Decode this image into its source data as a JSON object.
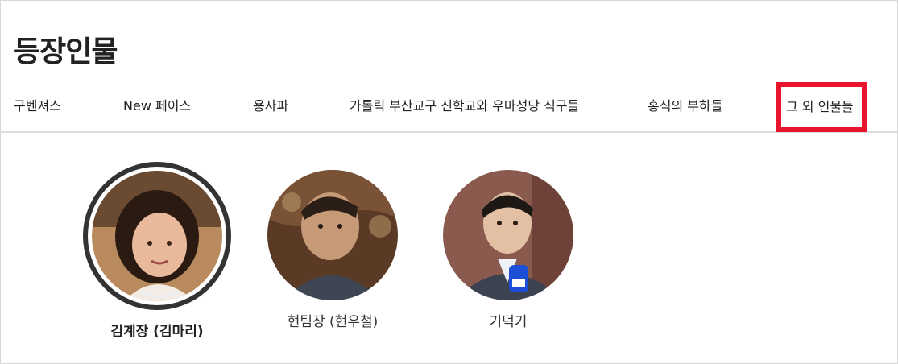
{
  "page": {
    "title": "등장인물"
  },
  "tabs": [
    {
      "label": "구벤져스"
    },
    {
      "label": "New 페이스"
    },
    {
      "label": "용사파"
    },
    {
      "label": "가톨릭 부산교구 신학교와 우마성당 식구들"
    },
    {
      "label": "홍식의 부하들"
    },
    {
      "label": "그 외 인물들",
      "active": true
    }
  ],
  "characters": [
    {
      "name": "김계장 (김마리)",
      "selected": true
    },
    {
      "name": "현팀장 (현우철)",
      "selected": false
    },
    {
      "name": "기덕기",
      "selected": false
    }
  ],
  "colors": {
    "highlight": "#e8132d",
    "ring": "#333333"
  }
}
